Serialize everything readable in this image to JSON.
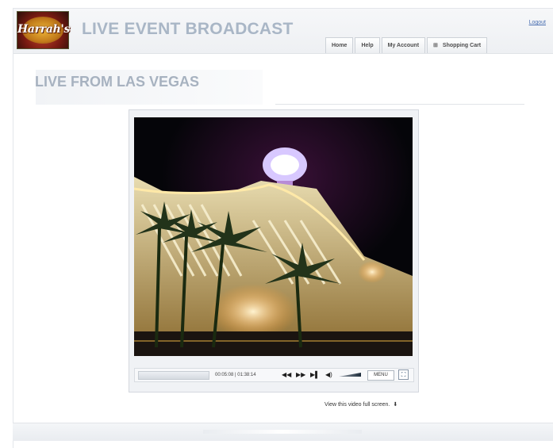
{
  "header": {
    "logo_text": "Harrah's",
    "title": "LIVE EVENT BROADCAST",
    "logout": "Logout",
    "nav": [
      {
        "label": "Home"
      },
      {
        "label": "Help"
      },
      {
        "label": "My Account"
      },
      {
        "label": "Shopping Cart",
        "icon": "cart-icon"
      }
    ]
  },
  "page": {
    "title": "LIVE FROM LAS VEGAS"
  },
  "player": {
    "time": "00:05:08 | 01:38:14",
    "menu_label": "MENU",
    "fullscreen_link": "View this video full screen."
  },
  "colors": {
    "title_gray_blue": "#a9b6c6",
    "link_blue": "#4a6fb0"
  }
}
